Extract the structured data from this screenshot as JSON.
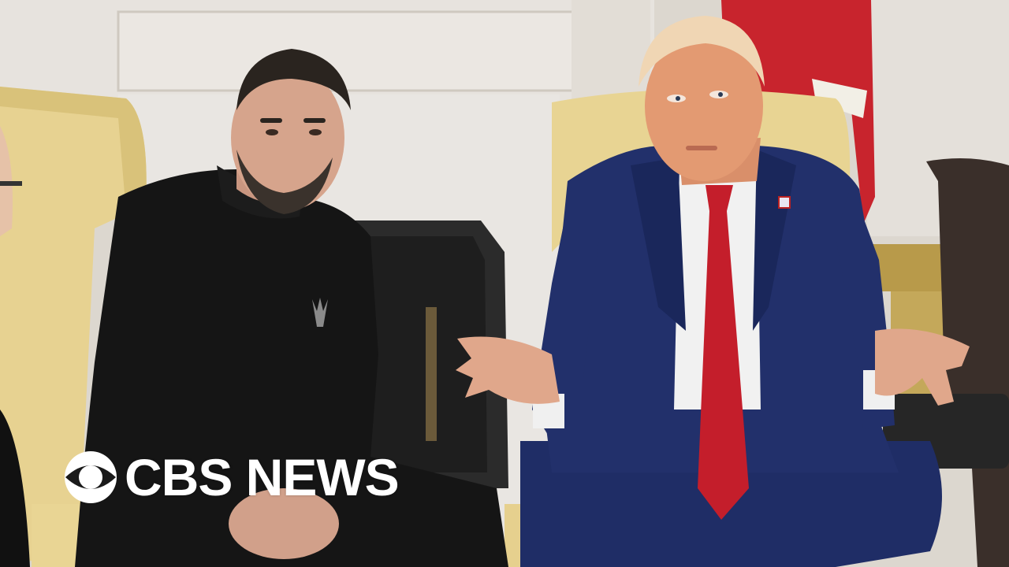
{
  "scene": {
    "description_colors": {
      "wall": "#dcd7cf",
      "fireplace_opening": "#2a2a2a",
      "chair_gold": "#e7d291",
      "flag_red": "#c8242d",
      "suit_navy": "#1f2d66",
      "tie_red": "#c41e2b",
      "shirt_white": "#f1f1f1",
      "sweater_black": "#151515"
    }
  },
  "logo": {
    "wordmark": "CBS NEWS",
    "icon": "cbs-eye-icon",
    "color": "#ffffff"
  }
}
